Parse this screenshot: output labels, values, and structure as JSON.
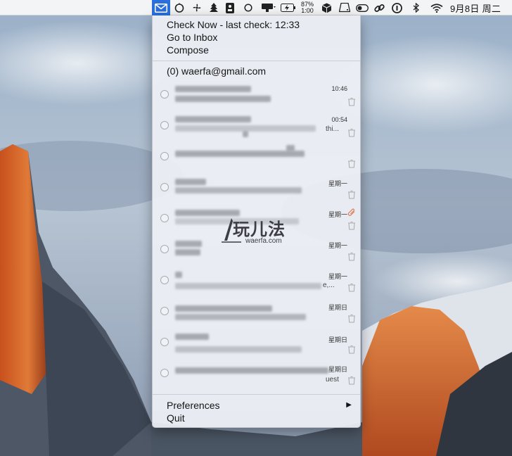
{
  "menubar": {
    "battery_percent": "87%",
    "battery_time": "1:00",
    "clock": "9月8日 周二"
  },
  "menu": {
    "check_now": "Check Now - last check: 12:33",
    "go_to_inbox": "Go to Inbox",
    "compose": "Compose",
    "account": "(0) waerfa@gmail.com",
    "preferences": "Preferences",
    "quit": "Quit"
  },
  "emails": [
    {
      "time": "10:46",
      "snippet": ""
    },
    {
      "time": "00:54",
      "snippet": "thi..."
    },
    {
      "time": "",
      "snippet": ""
    },
    {
      "time": "星期一",
      "snippet": ""
    },
    {
      "time": "星期一",
      "snippet": ""
    },
    {
      "time": "星期一",
      "snippet": ""
    },
    {
      "time": "星期一",
      "snippet": "e,..."
    },
    {
      "time": "星期日",
      "snippet": ""
    },
    {
      "time": "星期日",
      "snippet": ""
    },
    {
      "time": "星期日",
      "snippet": "uest"
    }
  ],
  "watermark": {
    "main": "玩儿法",
    "sub": "waerfa.com"
  },
  "icons": [
    "mail-icon",
    "timer-icon",
    "fan-icon",
    "tree-icon",
    "safe-icon",
    "circle-icon",
    "display-icon",
    "battery-icon",
    "box-icon",
    "drive-icon",
    "toggle-icon",
    "link-icon",
    "info-icon",
    "bluetooth-icon",
    "wifi-icon"
  ]
}
